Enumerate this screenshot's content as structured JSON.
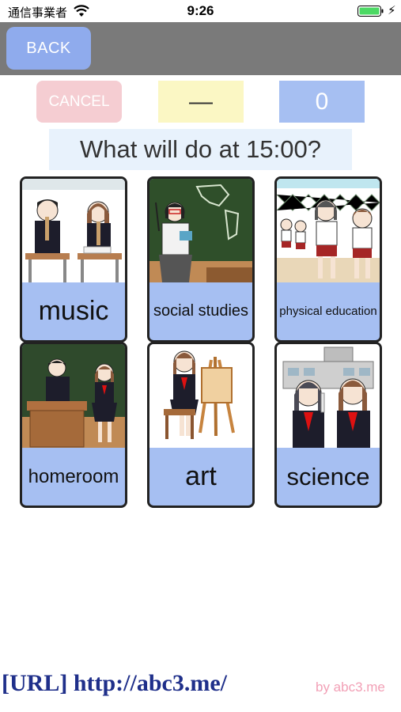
{
  "status_bar": {
    "carrier": "通信事業者",
    "time": "9:26",
    "wifi_icon": "wifi-icon",
    "battery_icon": "battery-icon",
    "charging_icon": "charging-bolt-icon",
    "charging_glyph": "⚡"
  },
  "nav": {
    "back_label": "BACK"
  },
  "controls": {
    "cancel_label": "CANCEL",
    "answer_value": "—",
    "score_value": "0"
  },
  "question": "What will do at 15:00?",
  "cards": [
    {
      "label": "music",
      "image": "music-class-illustration"
    },
    {
      "label": "social studies",
      "image": "social-studies-class-illustration"
    },
    {
      "label": "physical education",
      "image": "physical-education-class-illustration"
    },
    {
      "label": "homeroom",
      "image": "homeroom-class-illustration"
    },
    {
      "label": "art",
      "image": "art-class-illustration"
    },
    {
      "label": "science",
      "image": "science-class-illustration"
    }
  ],
  "footer": {
    "url_text": "[URL] http://abc3.me/",
    "credit": "by abc3.me"
  },
  "colors": {
    "nav_bar": "#7a7a7a",
    "back_button": "#8fabed",
    "cancel_button": "#f5cdd2",
    "answer_box": "#fbf7c4",
    "score_box": "#a6bff2",
    "question_bg": "#e8f2fc",
    "card_label_bg": "#a6bff2",
    "url_text": "#1f2f8a",
    "credit_text": "#f2a0b6"
  }
}
